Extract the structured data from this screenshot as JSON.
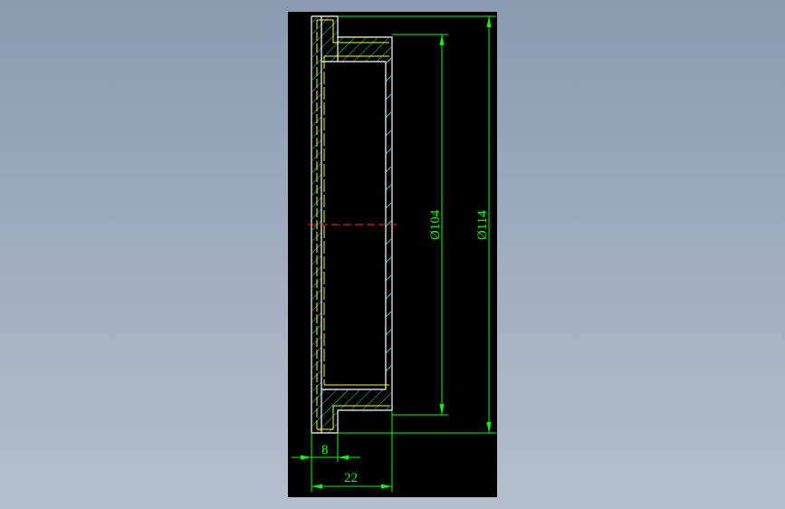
{
  "drawing": {
    "background": "#000000",
    "colors": {
      "outline": "#ffffff",
      "hatch": "#00e0e0",
      "hidden": "#ffff00",
      "dimension": "#00ff00",
      "centerline": "#ff0000"
    },
    "dimensions": {
      "inner_diameter": "Ø104",
      "outer_diameter": "Ø114",
      "flange_width": "8",
      "total_width": "22"
    }
  }
}
